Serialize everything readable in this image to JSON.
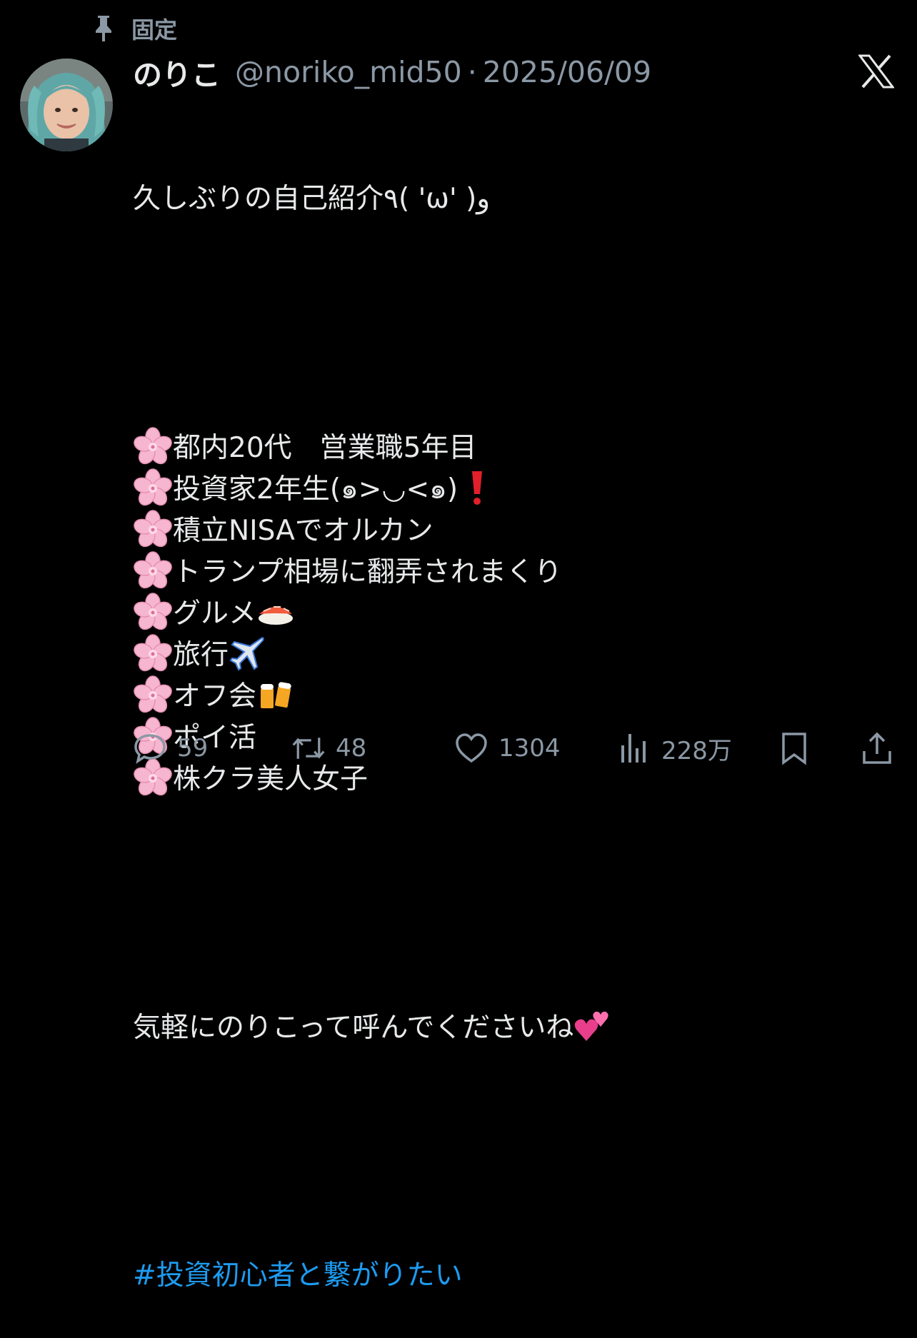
{
  "pinned": {
    "label": "固定",
    "icon": "pin-icon"
  },
  "author": {
    "name": "のりこ",
    "handle": "@noriko_mid50",
    "separator": "·",
    "date": "2025/06/09"
  },
  "x_logo": "x-logo-icon",
  "tweet": {
    "intro": "久しぶりの自己紹介٩( 'ω' )و",
    "items": [
      {
        "text": "都内20代　営業職5年目",
        "emoji": ""
      },
      {
        "text": "投資家2年生(๑>◡<๑)",
        "emoji": "exclamation"
      },
      {
        "text": "積立NISAでオルカン",
        "emoji": ""
      },
      {
        "text": "トランプ相場に翻弄されまくり",
        "emoji": ""
      },
      {
        "text": "グルメ",
        "emoji": "sushi"
      },
      {
        "text": "旅行",
        "emoji": "airplane"
      },
      {
        "text": "オフ会",
        "emoji": "beer"
      },
      {
        "text": "ポイ活",
        "emoji": ""
      },
      {
        "text": "株クラ美人女子",
        "emoji": ""
      }
    ],
    "outro": "気軽にのりこって呼んでくださいね",
    "hashtag": "#投資初心者と繋がりたい"
  },
  "actions": {
    "reply_count": "59",
    "retweet_count": "48",
    "like_count": "1304",
    "views_count": "228万"
  },
  "colors": {
    "background": "#000000",
    "text": "#e7e9ea",
    "muted": "#8b98a5",
    "link": "#1d9bf0",
    "blossom": "#f7b6cf"
  }
}
